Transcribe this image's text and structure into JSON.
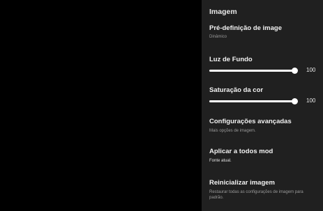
{
  "panel": {
    "title": "Imagem"
  },
  "items": {
    "preset": {
      "label": "Pré-definição de image",
      "value": "Dinâmico"
    },
    "backlight": {
      "label": "Luz de Fundo",
      "value": "100",
      "level_percent": 100
    },
    "saturation": {
      "label": "Saturação da cor",
      "value": "100",
      "level_percent": 100
    },
    "advanced": {
      "label": "Configurações avançadas",
      "description": "Mais opções de imagem."
    },
    "apply_all": {
      "label": "Aplicar a todos mod",
      "description": "Fonte atual."
    },
    "reset": {
      "label": "Reinicializar imagem",
      "description": "Restaurar todas as configurações de imagem para padrão."
    }
  },
  "colors": {
    "panel_background": "#202020",
    "video_background": "#000000",
    "slider": "#ffffff"
  }
}
